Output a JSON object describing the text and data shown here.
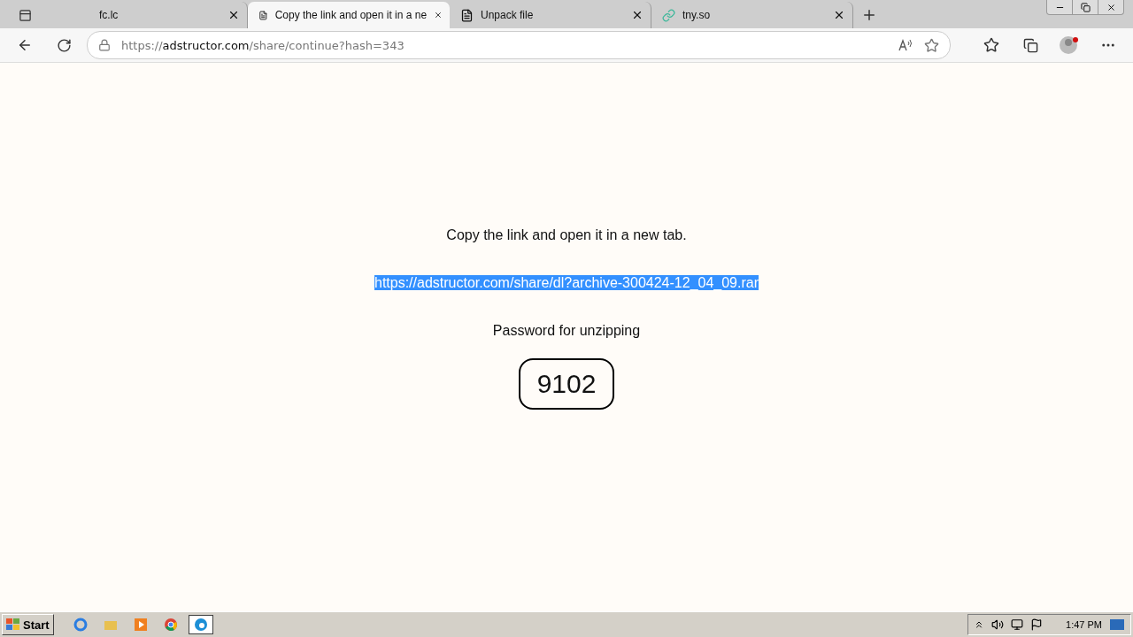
{
  "tabs": [
    {
      "label": "fc.lc",
      "kind": "blank",
      "selected": false
    },
    {
      "label": "Copy the link and open it in a ne",
      "kind": "page",
      "selected": true
    },
    {
      "label": "Unpack file",
      "kind": "page",
      "selected": false
    },
    {
      "label": "tny.so",
      "kind": "link",
      "selected": false
    }
  ],
  "address_bar": {
    "scheme": "https://",
    "host": "adstructor.com",
    "path": "/share/continue?hash=343"
  },
  "page": {
    "instruction": "Copy the link and open it in a new tab.",
    "link": {
      "text": "https://adstructor.com/share/dl?archive-300424-12_04_09.rar",
      "selected": true
    },
    "password_label": "Password for unzipping",
    "password": "9102"
  },
  "taskbar": {
    "start": "Start",
    "apps": [
      {
        "kind": "ie",
        "selected": false
      },
      {
        "kind": "folder",
        "selected": false
      },
      {
        "kind": "media",
        "selected": false
      },
      {
        "kind": "chrome",
        "selected": false
      },
      {
        "kind": "edge",
        "selected": true
      }
    ],
    "clock": "1:47 PM"
  }
}
